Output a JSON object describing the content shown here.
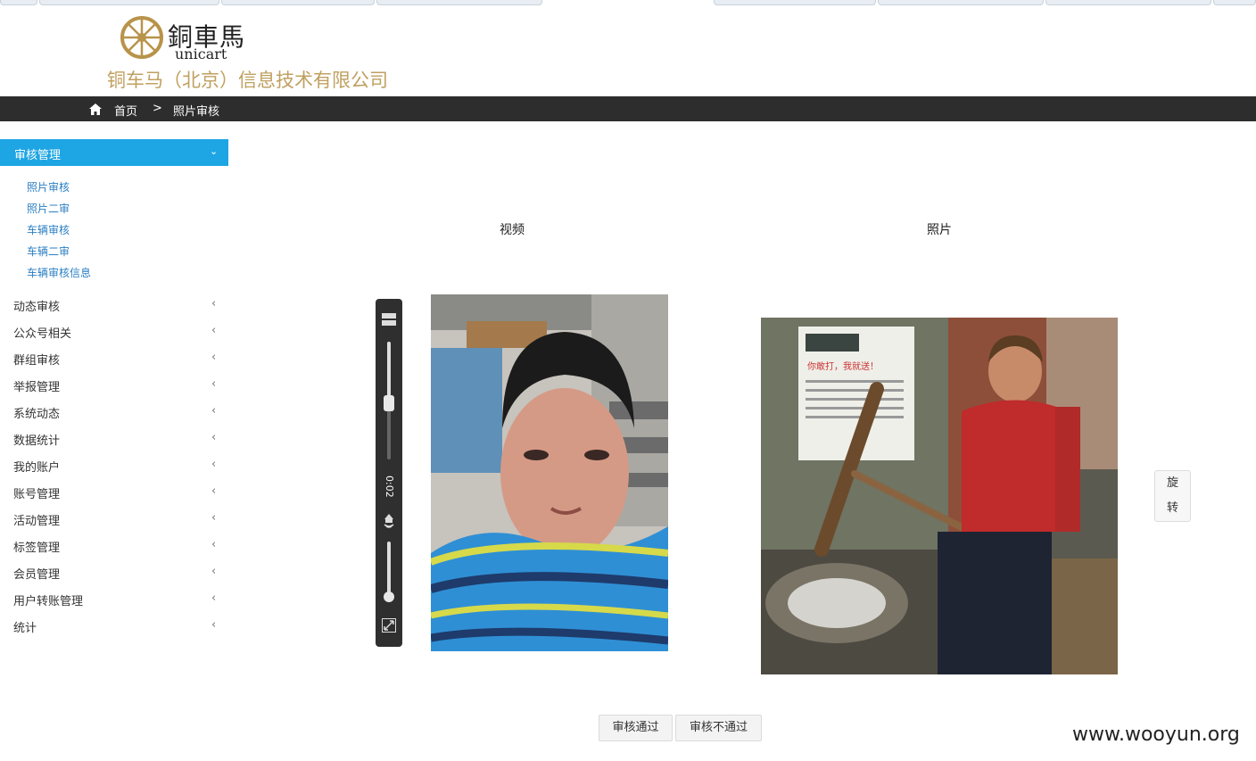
{
  "header": {
    "logo_cn": "銅車馬",
    "logo_en": "unicart",
    "company": "铜车马（北京）信息技术有限公司"
  },
  "breadcrumb": {
    "home": "首页",
    "separator": ">",
    "current": "照片审核"
  },
  "sidebar": {
    "active_group": {
      "label": "审核管理",
      "chevron": "⌄"
    },
    "sub_items": [
      "照片审核",
      "照片二审",
      "车辆审核",
      "车辆二审",
      "车辆审核信息"
    ],
    "groups": [
      "动态审核",
      "公众号相关",
      "群组审核",
      "举报管理",
      "系统动态",
      "数据统计",
      "我的账户",
      "账号管理",
      "活动管理",
      "标签管理",
      "会员管理",
      "用户转账管理",
      "统计"
    ],
    "group_arrow": "‹"
  },
  "main": {
    "video_label": "视频",
    "photo_label": "照片",
    "video_time": "0:02",
    "rotate_button": [
      "旋",
      "转"
    ],
    "approve_button": "审核通过",
    "reject_button": "审核不通过"
  },
  "watermark": "www.wooyun.org",
  "colors": {
    "accent": "#1ea5e3",
    "breadcrumb_bg": "#2d2d2d",
    "company_text": "#c0a060"
  }
}
